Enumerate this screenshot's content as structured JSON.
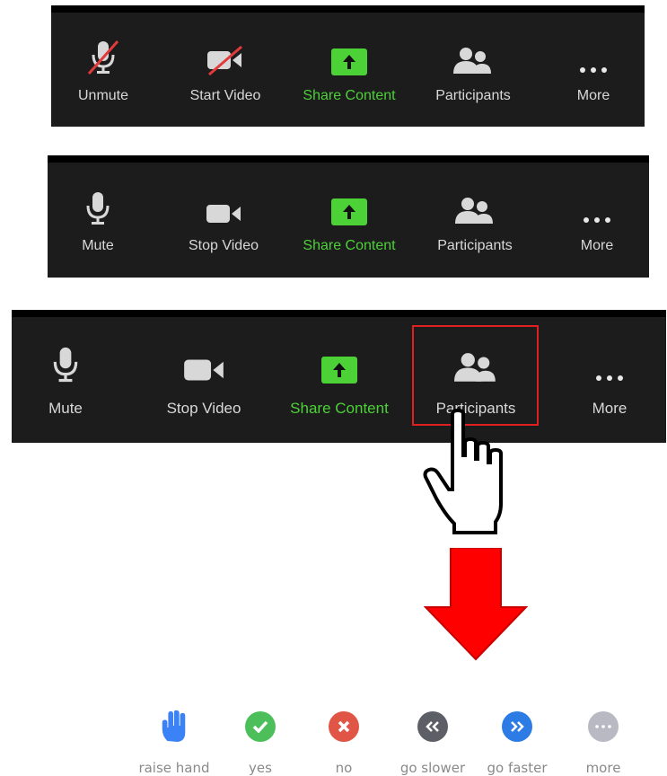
{
  "toolbar_muted": {
    "buttons": [
      {
        "label": "Unmute",
        "icon": "muted-microphone-icon"
      },
      {
        "label": "Start Video",
        "icon": "video-off-icon"
      },
      {
        "label": "Share Content",
        "icon": "share-arrow-icon"
      },
      {
        "label": "Participants",
        "icon": "participants-icon"
      },
      {
        "label": "More",
        "icon": "more-dots-icon"
      }
    ]
  },
  "toolbar_active": {
    "buttons": [
      {
        "label": "Mute",
        "icon": "microphone-icon"
      },
      {
        "label": "Stop Video",
        "icon": "video-camera-icon"
      },
      {
        "label": "Share Content",
        "icon": "share-arrow-icon"
      },
      {
        "label": "Participants",
        "icon": "participants-icon"
      },
      {
        "label": "More",
        "icon": "more-dots-icon"
      }
    ]
  },
  "toolbar_highlighted": {
    "buttons": [
      {
        "label": "Mute",
        "icon": "microphone-icon"
      },
      {
        "label": "Stop Video",
        "icon": "video-camera-icon"
      },
      {
        "label": "Share Content",
        "icon": "share-arrow-icon"
      },
      {
        "label": "Participants",
        "icon": "participants-icon"
      },
      {
        "label": "More",
        "icon": "more-dots-icon"
      }
    ],
    "highlighted": "Participants"
  },
  "reactions": [
    {
      "label": "raise hand",
      "icon": "raise-hand-icon",
      "color": "#3b82f6"
    },
    {
      "label": "yes",
      "icon": "check-icon",
      "color": "#4cbf5a"
    },
    {
      "label": "no",
      "icon": "x-icon",
      "color": "#e05545"
    },
    {
      "label": "go slower",
      "icon": "double-chevron-left-icon",
      "color": "#5c5f66"
    },
    {
      "label": "go faster",
      "icon": "double-chevron-right-icon",
      "color": "#2d7be5"
    },
    {
      "label": "more",
      "icon": "more-dots-icon",
      "color": "#b8b9c2"
    }
  ],
  "colors": {
    "toolbar_bg": "#1c1c1c",
    "share_green": "#4cd137",
    "highlight_red": "#e02020",
    "arrow_red": "#ff0000"
  }
}
